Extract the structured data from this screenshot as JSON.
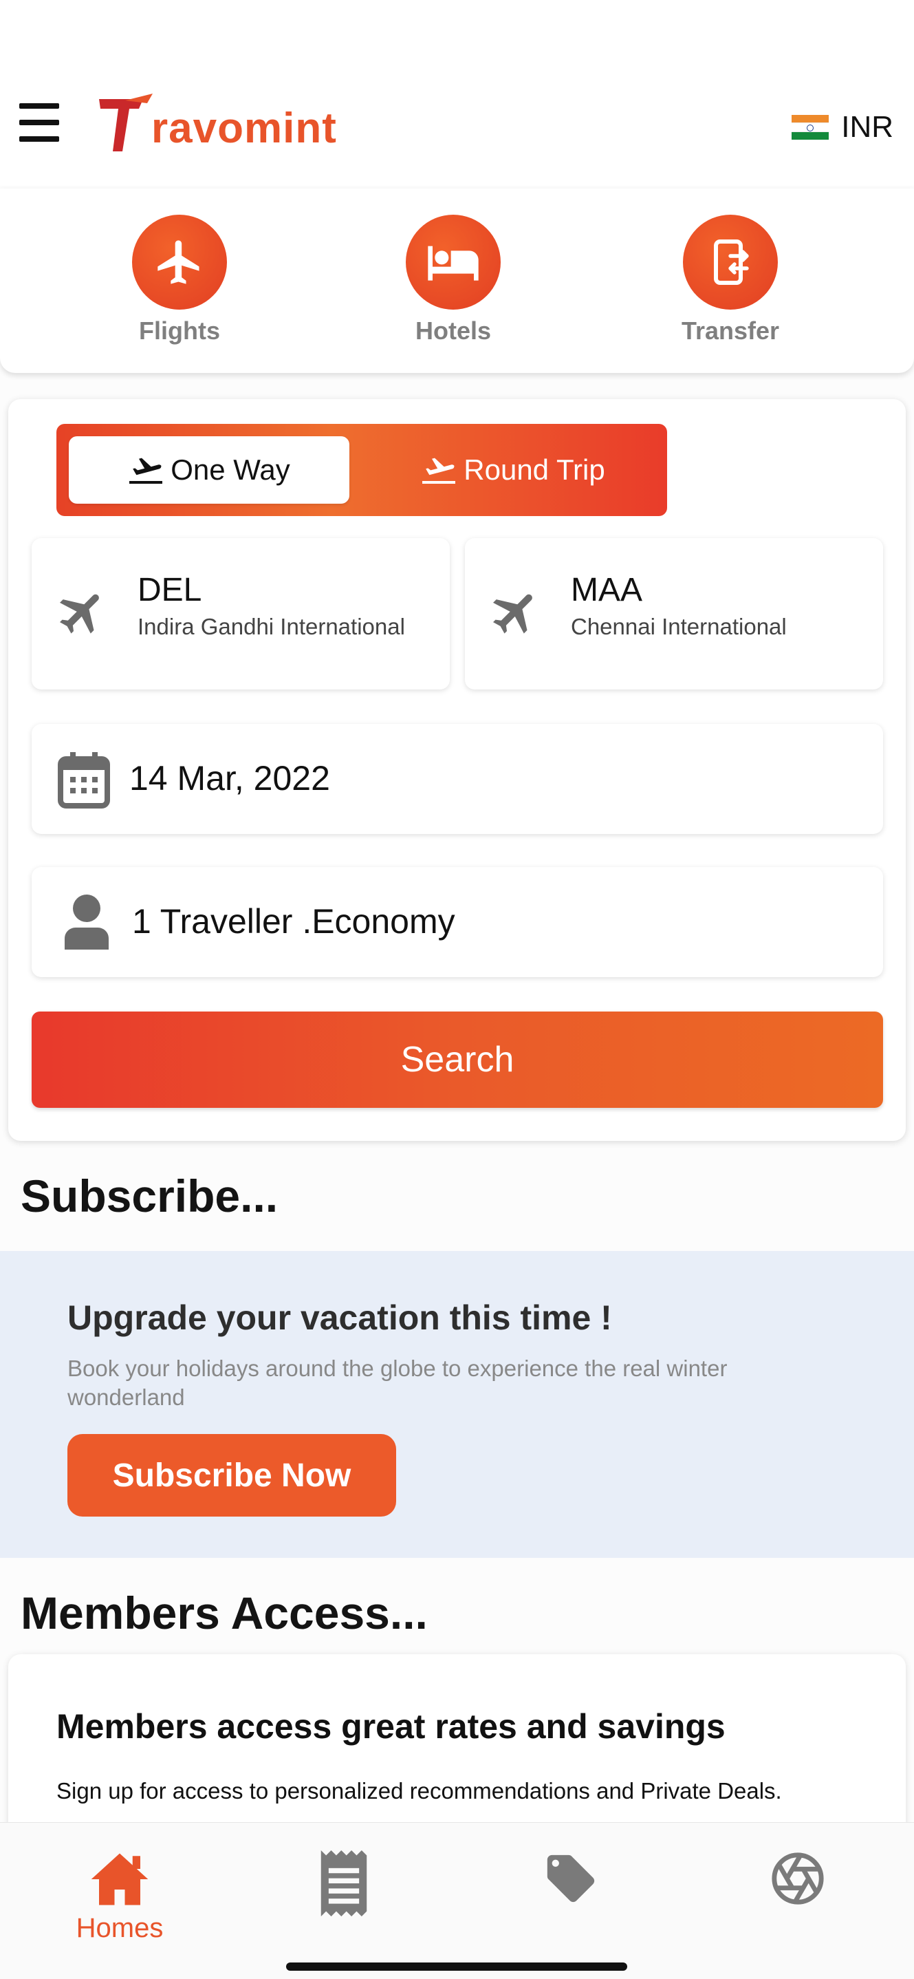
{
  "header": {
    "brand_name": "ravomint",
    "brand_full": "Travomint",
    "currency": "INR",
    "accent_color": "#e8542a"
  },
  "services": [
    {
      "label": "Flights",
      "icon": "airplane-icon"
    },
    {
      "label": "Hotels",
      "icon": "bed-icon"
    },
    {
      "label": "Transfer",
      "icon": "transfer-icon"
    }
  ],
  "search": {
    "trip_types": [
      "One Way",
      "Round Trip"
    ],
    "selected_trip": "One Way",
    "from": {
      "code": "DEL",
      "name": "Indira Gandhi International"
    },
    "to": {
      "code": "MAA",
      "name": "Chennai International"
    },
    "date": "14 Mar, 2022",
    "travellers": "1 Traveller .Economy",
    "search_label": "Search"
  },
  "subscribe": {
    "section_title": "Subscribe...",
    "heading": "Upgrade your vacation this time !",
    "description": "Book your holidays around the globe to experience the real winter wonderland",
    "button_label": "Subscribe Now"
  },
  "members": {
    "section_title": "Members Access...",
    "heading": "Members access great rates and savings",
    "description": "Sign up for access to personalized recommendations and Private Deals."
  },
  "bottom_nav": [
    {
      "label": "Homes",
      "icon": "home-icon",
      "active": true
    },
    {
      "label": "",
      "icon": "receipt-icon",
      "active": false
    },
    {
      "label": "",
      "icon": "tag-icon",
      "active": false
    },
    {
      "label": "",
      "icon": "aperture-icon",
      "active": false
    }
  ]
}
